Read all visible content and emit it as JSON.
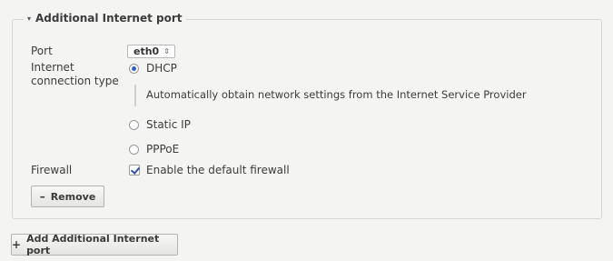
{
  "section": {
    "title": "Additional Internet port"
  },
  "port": {
    "label": "Port",
    "selected_value": "eth0",
    "arrows": "⇕"
  },
  "connection_type": {
    "label_line1": "Internet",
    "label_line2": "connection type",
    "options": [
      {
        "label": "DHCP",
        "checked": true
      },
      {
        "label": "Static IP",
        "checked": false
      },
      {
        "label": "PPPoE",
        "checked": false
      }
    ],
    "dhcp_help": "Automatically obtain network settings from the Internet Service Provider"
  },
  "firewall": {
    "label": "Firewall",
    "checkbox_label": "Enable the default firewall",
    "checked": true
  },
  "buttons": {
    "remove_label": "Remove",
    "remove_glyph": "–",
    "add_label": "Add Additional Internet port",
    "add_glyph": "+"
  },
  "icons": {
    "legend_caret": "▾"
  }
}
